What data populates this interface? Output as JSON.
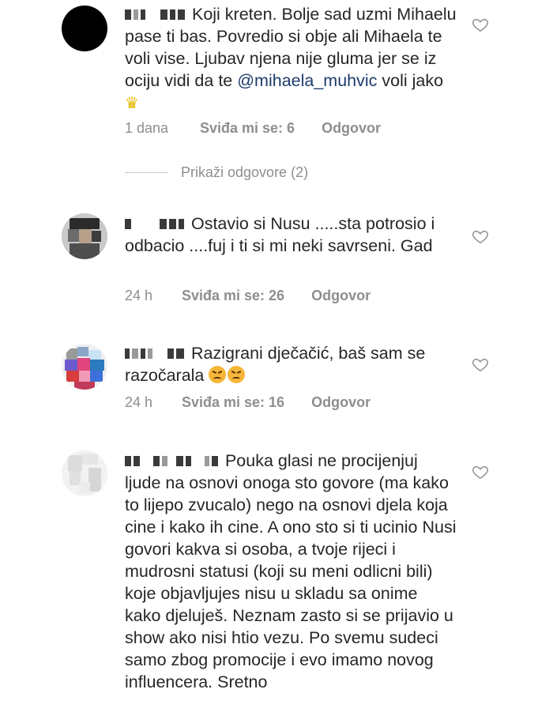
{
  "comments": [
    {
      "text_before": "Koji kreten. Bolje sad uzmi Mihaelu pase ti bas. Povredio si obje ali Mihaela te voli vise. Ljubav njena nije gluma jer se iz ociju vidi da te ",
      "mention": "@mihaela_muhvic",
      "text_after": "  voli jako ",
      "emoji": "crown",
      "time": "1 dana",
      "likes": "Sviđa mi se: 6",
      "reply": "Odgovor"
    },
    {
      "text": "Ostavio si Nusu .....sta potrosio i odbacio ....fuj i ti si mi neki savrseni.  Gad",
      "time": "24 h",
      "likes": "Sviđa mi se: 26",
      "reply": "Odgovor"
    },
    {
      "text": "Razigrani dječačić, baš sam se razočarala ",
      "emoji": "persevering-face x2",
      "time": "24 h",
      "likes": "Sviđa mi se: 16",
      "reply": "Odgovor"
    },
    {
      "text": "Pouka glasi ne procijenjuj ljude na osnovi onoga sto govore (ma kako to lijepo zvucalo) nego na osnovi djela koja cine i kako ih cine. A ono sto si ti ucinio Nusi govori kakva si osoba, a  tvoje rijeci i mudrosni statusi (koji su meni odlicni bili) koje objavljujes nisu u skladu sa onime kako djeluješ. Neznam zasto si se prijavio u show ako nisi htio vezu. Po svemu sudeci samo zbog promocije i evo imamo novog influencera. Sretno"
    }
  ],
  "view_replies": "Prikaži odgovore (2)",
  "icons": {
    "like": "heart-outline-icon"
  },
  "colors": {
    "mention": "#1e3c6e",
    "meta": "#8e8e8e",
    "text": "#262626"
  }
}
